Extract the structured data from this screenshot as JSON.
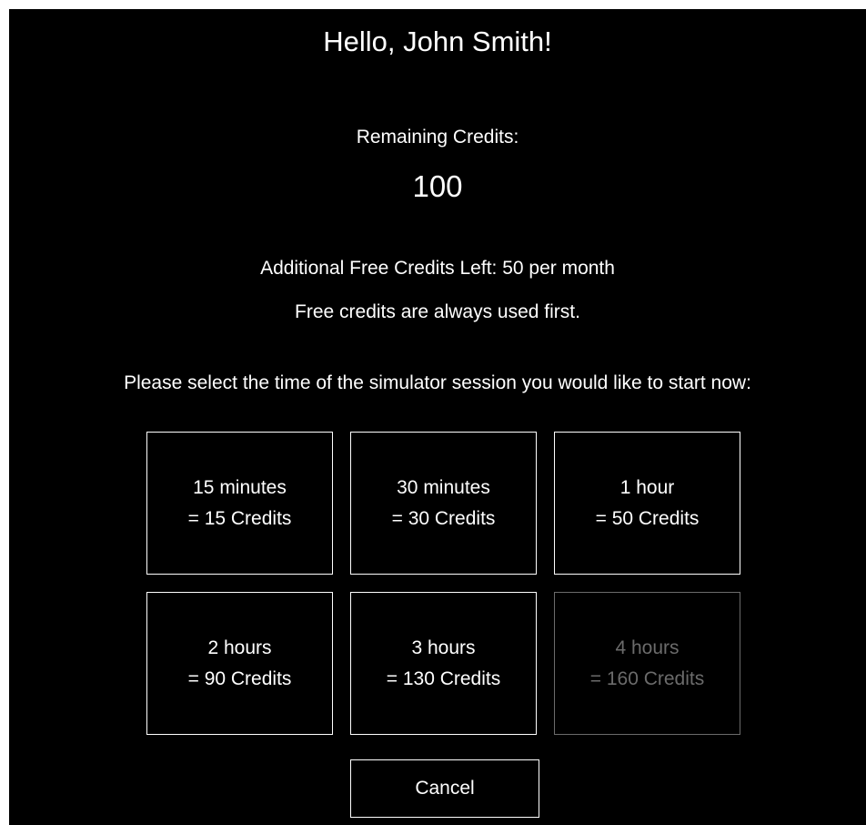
{
  "greeting": "Hello, John Smith!",
  "credits": {
    "label": "Remaining Credits:",
    "value": "100"
  },
  "free_credits": {
    "text": "Additional Free Credits Left: 50 per month",
    "note": "Free credits are always used first."
  },
  "prompt": "Please select the time of the simulator session you would like to start now:",
  "options": [
    {
      "time": "15 minutes",
      "cost": "= 15 Credits",
      "enabled": true
    },
    {
      "time": "30 minutes",
      "cost": "= 30 Credits",
      "enabled": true
    },
    {
      "time": "1 hour",
      "cost": "= 50 Credits",
      "enabled": true
    },
    {
      "time": "2 hours",
      "cost": "= 90 Credits",
      "enabled": true
    },
    {
      "time": "3 hours",
      "cost": "= 130 Credits",
      "enabled": true
    },
    {
      "time": "4 hours",
      "cost": "= 160 Credits",
      "enabled": false
    }
  ],
  "cancel_label": "Cancel",
  "colors": {
    "background": "#000000",
    "text": "#ffffff",
    "disabled": "#6b6b6b"
  }
}
